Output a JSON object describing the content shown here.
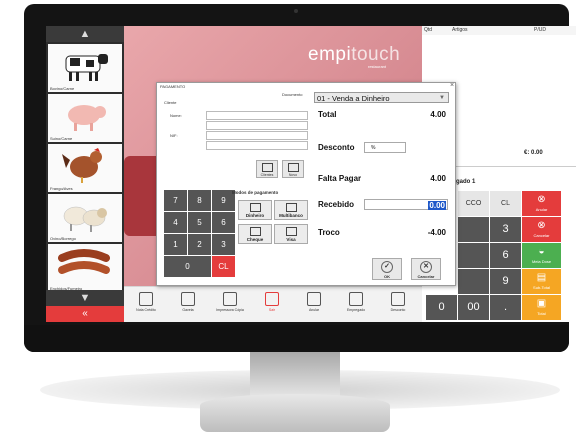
{
  "app": {
    "logo_main": "empi",
    "logo_accent": "touch",
    "logo_sub": "restaurant"
  },
  "products": [
    {
      "label": "Bovino/Carne",
      "icon": "cow-icon"
    },
    {
      "label": "Suino/Carne",
      "icon": "pig-icon"
    },
    {
      "label": "Frango/Aves",
      "icon": "chicken-icon"
    },
    {
      "label": "Ovino/Borrego",
      "icon": "sheep-icon"
    },
    {
      "label": "Enchidos/Fumeiro",
      "icon": "sausage-icon"
    }
  ],
  "left_nav": {
    "up": "▲",
    "down": "▼",
    "back": "«"
  },
  "right_panel": {
    "columns": [
      "Qtd",
      "Artigos",
      "P/UD"
    ],
    "total_left": "",
    "total_right": "€: 0.00",
    "subtitle": "gado 1",
    "keys": {
      "cco": "CCO",
      "cl": "CL",
      "n3": "3",
      "n6": "6",
      "n9": "9",
      "n0": "0",
      "n00": "00",
      "dot": "."
    },
    "actions": {
      "anular": "Anular",
      "cancelar": "Cancelar",
      "meia_dose": "Meia Dose",
      "sub_total": "Sub-Total",
      "total": "Total"
    },
    "colors": {
      "red": "#e43c3c",
      "green": "#4caf50",
      "orange": "#f5a623",
      "gray_key": "#555555"
    }
  },
  "toolbar": {
    "items": [
      "Nota Crédito",
      "Gaveta",
      "Impressora Cópia",
      "Sair",
      "Anular",
      "Empregado",
      "Desconto"
    ]
  },
  "dialog": {
    "title": "PAGAMENTO",
    "document_label": "Documento",
    "client_label": "Cliente",
    "name_label": "Nome:",
    "nif_label": "NIF:",
    "clients_button": "Clientes",
    "new_button": "Novo",
    "payment_modes_label": "Modos de pagamento",
    "payment_modes": [
      "Dinheiro",
      "Multibanco",
      "Cheque",
      "Visa"
    ],
    "numpad": [
      "7",
      "8",
      "9",
      "4",
      "5",
      "6",
      "1",
      "2",
      "3",
      "0",
      "CL"
    ],
    "document_type": "01 - Venda a Dinheiro",
    "total_label": "Total",
    "total_value": "4.00",
    "discount_label": "Desconto",
    "discount_unit": "%",
    "missing_label": "Falta Pagar",
    "missing_value": "4.00",
    "received_label": "Recebido",
    "received_value": "0.00",
    "change_label": "Troco",
    "change_value": "-4.00",
    "ok_button": "OK",
    "cancel_button": "Cancelar",
    "close": "×"
  }
}
